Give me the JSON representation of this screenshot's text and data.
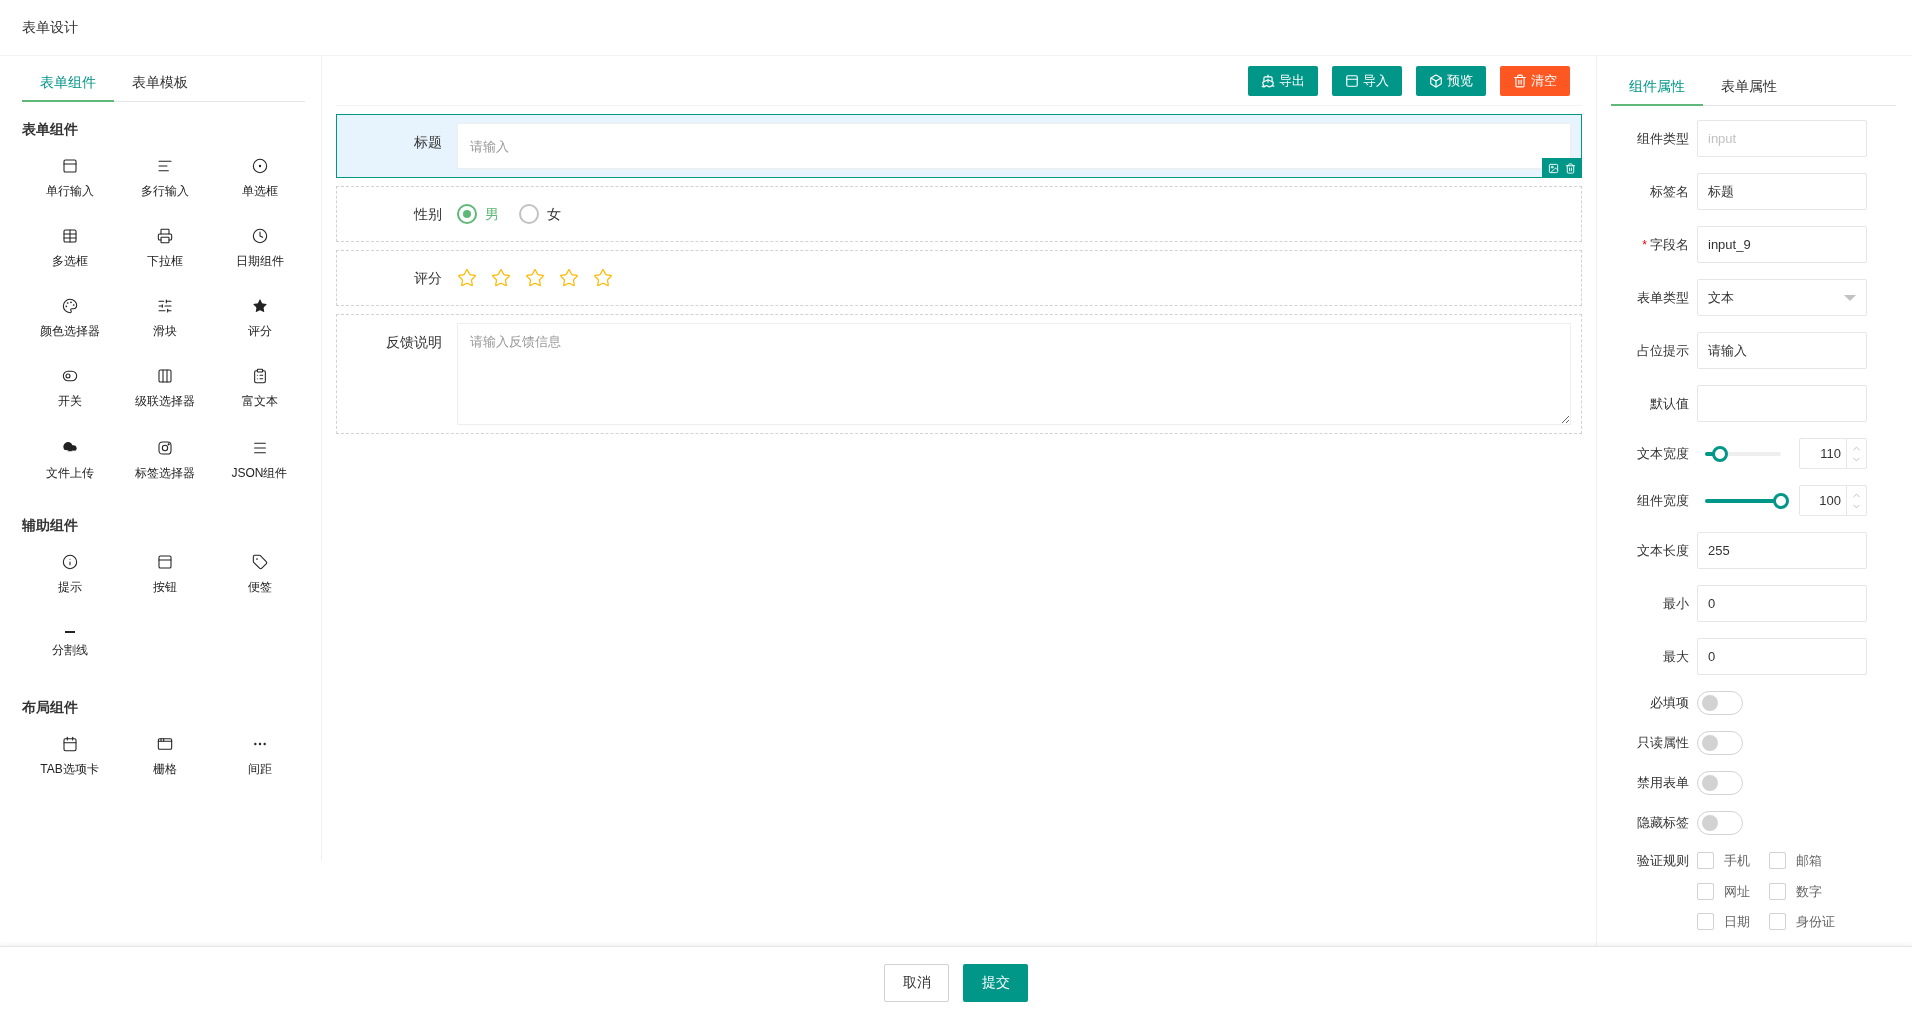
{
  "page_title": "表单设计",
  "left_tabs": [
    {
      "label": "表单组件",
      "selected": true
    },
    {
      "label": "表单模板",
      "selected": false
    }
  ],
  "palette_groups": [
    {
      "title": "表单组件",
      "items": [
        "单行输入",
        "多行输入",
        "单选框",
        "多选框",
        "下拉框",
        "日期组件",
        "颜色选择器",
        "滑块",
        "评分",
        "开关",
        "级联选择器",
        "富文本",
        "文件上传",
        "标签选择器",
        "JSON组件"
      ]
    },
    {
      "title": "辅助组件",
      "items": [
        "提示",
        "按钮",
        "便签",
        "分割线"
      ]
    },
    {
      "title": "布局组件",
      "items": [
        "TAB选项卡",
        "栅格",
        "间距"
      ]
    }
  ],
  "toolbar": [
    {
      "label": "导出",
      "kind": "primary"
    },
    {
      "label": "导入",
      "kind": "primary"
    },
    {
      "label": "预览",
      "kind": "primary"
    },
    {
      "label": "清空",
      "kind": "danger"
    }
  ],
  "form_fields": [
    {
      "kind": "input",
      "label": "标题",
      "placeholder": "请输入",
      "selected": true
    },
    {
      "kind": "radio",
      "label": "性别",
      "selected": false,
      "options": [
        {
          "label": "男",
          "selected": true
        },
        {
          "label": "女",
          "selected": false
        }
      ]
    },
    {
      "kind": "rate",
      "label": "评分",
      "selected": false,
      "stars": 0
    },
    {
      "kind": "textarea",
      "label": "反馈说明",
      "placeholder": "请输入反馈信息",
      "selected": false
    }
  ],
  "right_tabs": [
    {
      "label": "组件属性",
      "selected": true
    },
    {
      "label": "表单属性",
      "selected": false
    }
  ],
  "properties": [
    {
      "kind": "input",
      "label": "组件类型",
      "placeholder": "input"
    },
    {
      "kind": "input",
      "label": "标签名",
      "value": "标题"
    },
    {
      "kind": "input",
      "label": "字段名",
      "value": "input_9",
      "required_mark": "*"
    },
    {
      "kind": "select",
      "label": "表单类型",
      "value": "文本"
    },
    {
      "kind": "input",
      "label": "占位提示",
      "value": "请输入"
    },
    {
      "kind": "input",
      "label": "默认值"
    },
    {
      "kind": "slider",
      "label": "文本宽度",
      "level": 0.2,
      "value": "110"
    },
    {
      "kind": "slider",
      "label": "组件宽度",
      "level": 1,
      "value": "100"
    },
    {
      "kind": "input",
      "label": "文本长度",
      "value": "255"
    },
    {
      "kind": "input",
      "label": "最小",
      "value": "0"
    },
    {
      "kind": "input",
      "label": "最大",
      "value": "0"
    },
    {
      "kind": "switch",
      "label": "必填项",
      "on": false
    },
    {
      "kind": "switch",
      "label": "只读属性",
      "on": false
    },
    {
      "kind": "switch",
      "label": "禁用表单",
      "on": false
    },
    {
      "kind": "switch",
      "label": "隐藏标签",
      "on": false
    },
    {
      "kind": "checks",
      "label": "验证规则",
      "options": [
        {
          "label": "手机",
          "checked": false
        },
        {
          "label": "邮箱",
          "checked": false
        },
        {
          "label": "网址",
          "checked": false
        },
        {
          "label": "数字",
          "checked": false
        },
        {
          "label": "日期",
          "checked": false
        },
        {
          "label": "身份证",
          "checked": false
        }
      ]
    }
  ],
  "footer_buttons": [
    {
      "label": "取消",
      "kind": "default"
    },
    {
      "label": "提交",
      "kind": "primary"
    }
  ]
}
